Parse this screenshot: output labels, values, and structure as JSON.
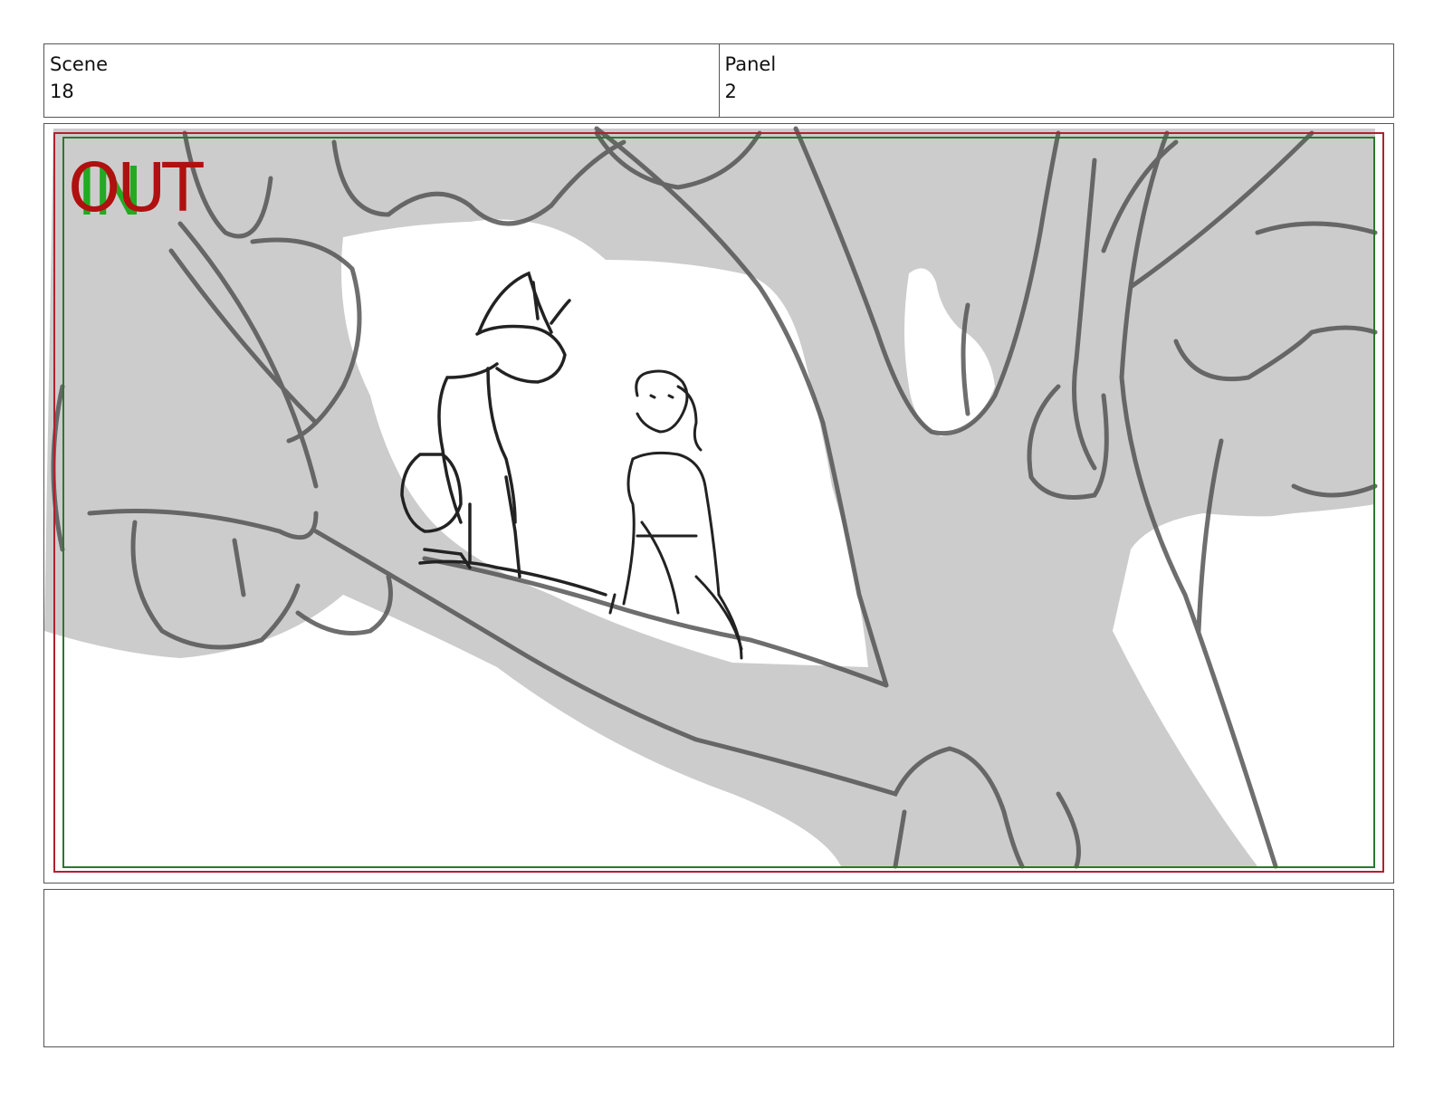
{
  "header": {
    "scene_label": "Scene",
    "scene_value": "18",
    "panel_label": "Panel",
    "panel_value": "2"
  },
  "frame": {
    "in_marker": "IN",
    "out_marker": "OUT",
    "colors": {
      "in": "#22aa22",
      "out": "#b01010",
      "tone": "#cccccc",
      "line": "#555555"
    }
  },
  "notes": {
    "text": ""
  }
}
